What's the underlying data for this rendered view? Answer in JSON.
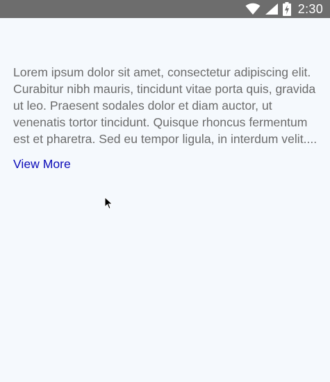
{
  "status_bar": {
    "time": "2:30",
    "icons": [
      "wifi-icon",
      "signal-icon",
      "battery-charging-icon"
    ]
  },
  "main": {
    "body_text": "Lorem ipsum dolor sit amet, consectetur adipiscing elit. Curabitur nibh mauris, tincidunt vitae porta quis, gravida ut leo. Praesent sodales dolor et diam auctor, ut venenatis tortor tincidunt. Quisque rhoncus fermentum est et pharetra. Sed eu tempor ligula, in interdum velit....",
    "view_more_label": "View More"
  },
  "colors": {
    "background": "#f5f9fd",
    "status_bar": "#6d6d6d",
    "body_text": "#6b6b6b",
    "link": "#0a0ab8"
  }
}
